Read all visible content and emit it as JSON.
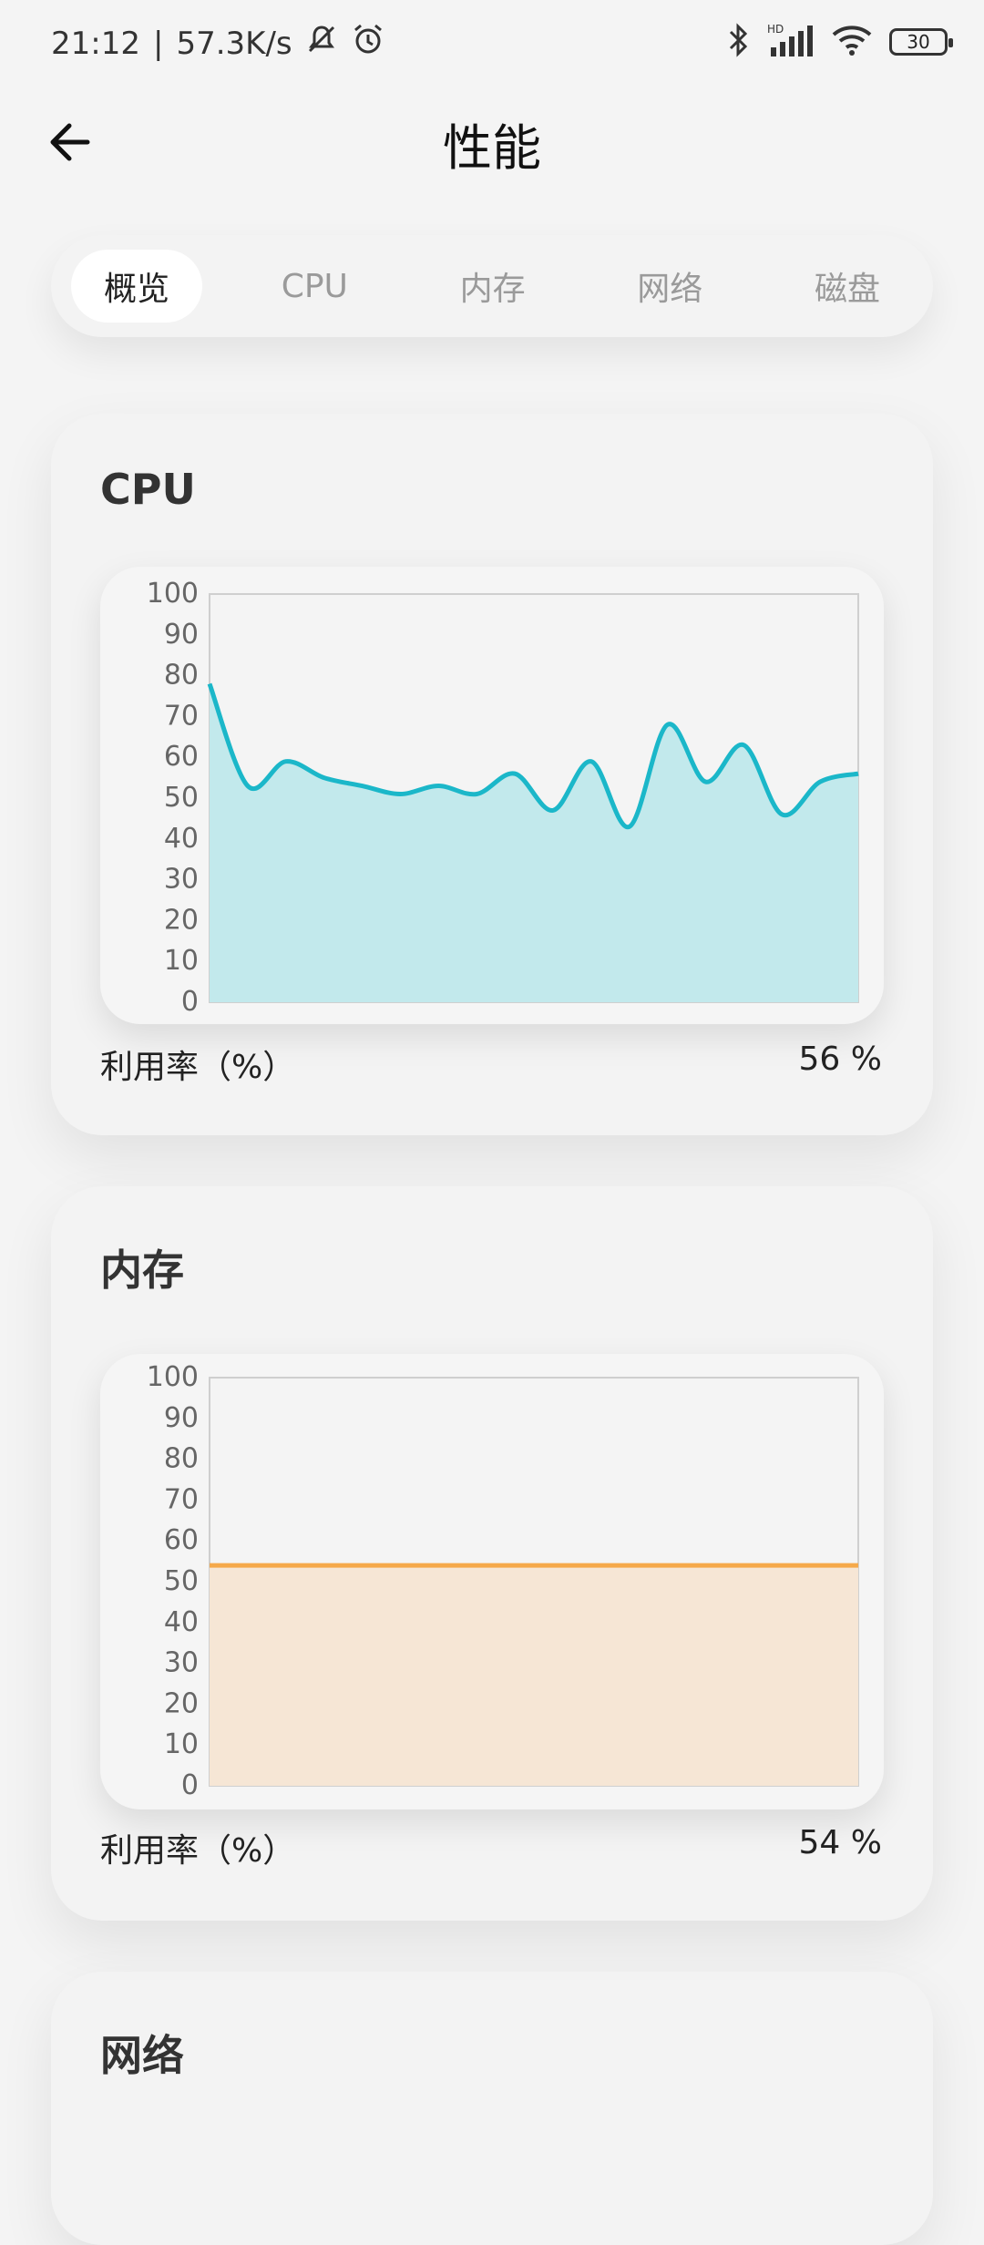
{
  "status_bar": {
    "time": "21:12",
    "network_speed": "57.3K/s",
    "battery": "30",
    "icons": [
      "silent-bell-icon",
      "alarm-icon",
      "bluetooth-icon",
      "hd-signal-icon",
      "wifi-icon",
      "battery-icon"
    ]
  },
  "header": {
    "title": "性能"
  },
  "tabs": [
    {
      "label": "概览",
      "active": true
    },
    {
      "label": "CPU",
      "active": false
    },
    {
      "label": "内存",
      "active": false
    },
    {
      "label": "网络",
      "active": false
    },
    {
      "label": "磁盘",
      "active": false
    }
  ],
  "cards": {
    "cpu": {
      "title": "CPU",
      "footer_label": "利用率（%）",
      "footer_value": "56 %"
    },
    "memory": {
      "title": "内存",
      "footer_label": "利用率（%）",
      "footer_value": "54 %"
    },
    "network": {
      "title": "网络"
    }
  },
  "chart_data": [
    {
      "type": "area",
      "title": "CPU",
      "ylim": [
        0,
        100
      ],
      "yticks": [
        0,
        10,
        20,
        30,
        40,
        50,
        60,
        70,
        80,
        90,
        100
      ],
      "values": [
        78,
        53,
        59,
        55,
        53,
        51,
        53,
        51,
        56,
        47,
        59,
        43,
        68,
        54,
        63,
        46,
        54,
        56
      ],
      "line_color": "#1bb7c9",
      "fill_color": "#c2e9ec"
    },
    {
      "type": "area",
      "title": "内存",
      "ylim": [
        0,
        100
      ],
      "yticks": [
        0,
        10,
        20,
        30,
        40,
        50,
        60,
        70,
        80,
        90,
        100
      ],
      "values": [
        54,
        54
      ],
      "line_color": "#f5a94a",
      "fill_color": "#f6e6d5"
    }
  ]
}
